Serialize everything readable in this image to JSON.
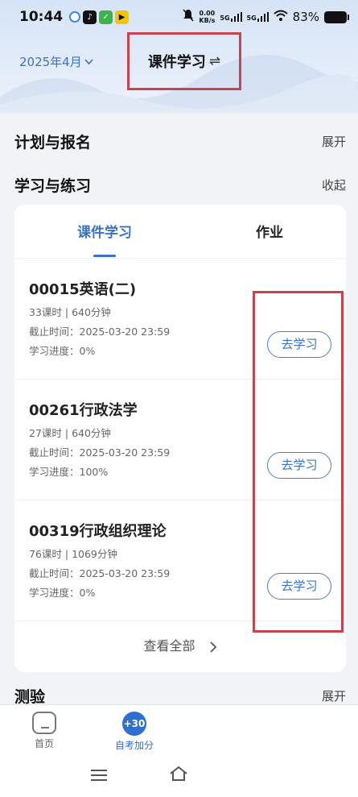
{
  "status_bar": {
    "time": "10:44",
    "net_speed_value": "0.00",
    "net_speed_unit": "KB/s",
    "sig1": "5G",
    "sig2": "5G",
    "battery": "83%"
  },
  "header": {
    "month": "2025年4月",
    "title": "课件学习",
    "swap_symbol": "⇌"
  },
  "sections": {
    "plan": {
      "title": "计划与报名",
      "action": "展开"
    },
    "study": {
      "title": "学习与练习",
      "action": "收起"
    },
    "quiz": {
      "title": "测验",
      "action": "展开"
    }
  },
  "tabs": [
    {
      "label": "课件学习",
      "active": true
    },
    {
      "label": "作业",
      "active": false
    }
  ],
  "courses": [
    {
      "name": "00015英语(二)",
      "hours": "33课时 | 640分钟",
      "deadline": "截止时间：2025-03-20 23:59",
      "progress": "学习进度：0%",
      "button": "去学习"
    },
    {
      "name": "00261行政法学",
      "hours": "27课时 | 640分钟",
      "deadline": "截止时间：2025-03-20 23:59",
      "progress": "学习进度：100%",
      "button": "去学习"
    },
    {
      "name": "00319行政组织理论",
      "hours": "76课时 | 1069分钟",
      "deadline": "截止时间：2025-03-20 23:59",
      "progress": "学习进度：0%",
      "button": "去学习"
    }
  ],
  "view_all": "查看全部",
  "bottom_nav": {
    "home": "首页",
    "self_exam": "自考加分",
    "badge": "+30"
  },
  "colors": {
    "accent": "#3a73c4",
    "highlight": "#c9434e"
  }
}
